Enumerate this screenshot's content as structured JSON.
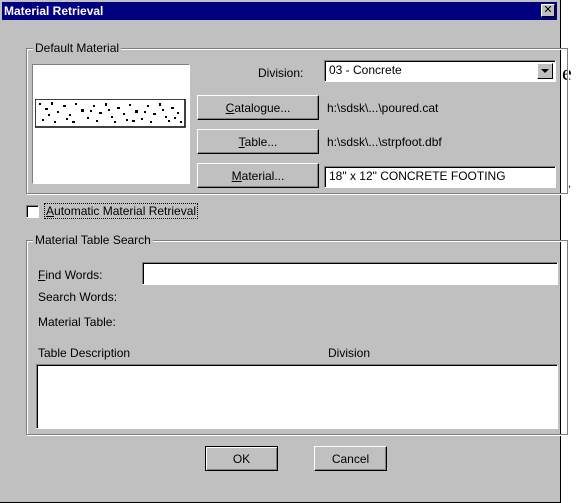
{
  "dialog": {
    "title": "Material Retrieval",
    "close_icon": "close-icon"
  },
  "default_material": {
    "group_label": "Default Material",
    "division_label": "Division:",
    "division_value": "03 - Concrete",
    "catalogue_button": "Catalogue...",
    "catalogue_path": "h:\\sdsk\\...\\poured.cat",
    "table_button": "Table...",
    "table_path": "h:\\sdsk\\...\\strpfoot.dbf",
    "material_button": "Material...",
    "material_value": "18\" x 12\" CONCRETE FOOTING",
    "preview_icon": "concrete-pattern-icon"
  },
  "auto_retrieval": {
    "label": "Automatic Material Retrieval",
    "checked": false
  },
  "search": {
    "group_label": "Material Table Search",
    "find_words_label": "Find Words:",
    "find_words_value": "",
    "search_words_label": "Search Words:",
    "material_table_label": "Material Table:",
    "col_description": "Table Description",
    "col_division": "Division"
  },
  "buttons": {
    "ok": "OK",
    "cancel": "Cancel"
  },
  "background": {
    "glyph_e": "e",
    "glyph_dot": "."
  },
  "colors": {
    "titlebar": "#000080",
    "face": "#c0c0c0"
  }
}
